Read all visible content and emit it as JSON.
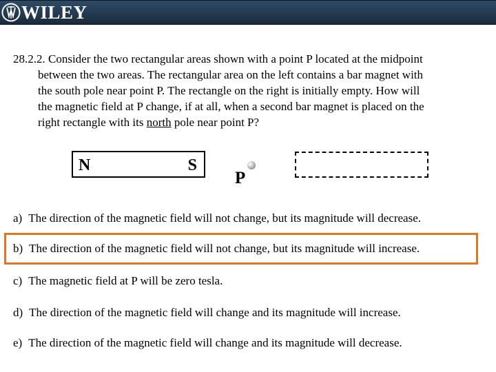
{
  "header": {
    "brand": "WILEY",
    "logo_icon": "wiley-emblem-icon",
    "colors": {
      "bar_top": "#2d4a66",
      "bar_bottom": "#1b2a3a",
      "text": "#ffffff"
    }
  },
  "question": {
    "number": "28.2.2.",
    "lines": [
      "Consider the two rectangular areas shown with a point P located at the midpoint",
      "between the two areas.  The rectangular area on the left contains a bar magnet with",
      "the south pole near point P.  The rectangle on the right is initially empty.  How will",
      "the magnetic field at P change, if at all, when a second bar magnet is placed on the"
    ],
    "last_line_before": "right rectangle with its ",
    "last_line_underlined": "north",
    "last_line_after": " pole near point P?"
  },
  "diagram": {
    "magnet_left_pole": "N",
    "magnet_right_pole": "S",
    "point_label": "P",
    "empty_area": "dashed-rectangle"
  },
  "answers": [
    {
      "letter": "a)",
      "text": "The direction of the magnetic field will not change, but its magnitude will decrease."
    },
    {
      "letter": "b)",
      "text": "The direction of the magnetic field will not change, but its magnitude will increase.",
      "highlighted": true
    },
    {
      "letter": "c)",
      "text": "The magnetic field at P will be zero tesla."
    },
    {
      "letter": "d)",
      "text": "The direction of the magnetic field will change and its magnitude will increase."
    },
    {
      "letter": "e)",
      "text": "The direction of the magnetic field will change and its magnitude will decrease."
    }
  ],
  "highlight_color": "#e07522"
}
